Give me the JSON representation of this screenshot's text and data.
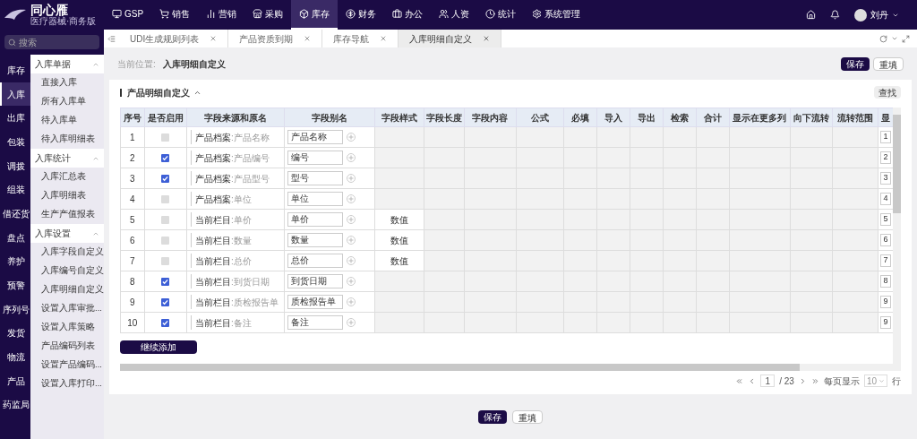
{
  "brand": {
    "name": "同心雁",
    "tagline": "医疗器械·商务版"
  },
  "top_nav": [
    {
      "label": "GSP",
      "selected": false
    },
    {
      "label": "销售",
      "selected": false
    },
    {
      "label": "营销",
      "selected": false
    },
    {
      "label": "采购",
      "selected": false
    },
    {
      "label": "库存",
      "selected": true
    },
    {
      "label": "财务",
      "selected": false
    },
    {
      "label": "办公",
      "selected": false
    },
    {
      "label": "人资",
      "selected": false
    },
    {
      "label": "统计",
      "selected": false
    },
    {
      "label": "系统管理",
      "selected": false
    }
  ],
  "user": {
    "name": "刘丹"
  },
  "search": {
    "placeholder": "搜索"
  },
  "side_nav": [
    {
      "label": "库存",
      "selected": false
    },
    {
      "label": "入库",
      "selected": true
    },
    {
      "label": "出库",
      "selected": false
    },
    {
      "label": "包装",
      "selected": false
    },
    {
      "label": "调拨",
      "selected": false
    },
    {
      "label": "组装",
      "selected": false
    },
    {
      "label": "借还货",
      "selected": false
    },
    {
      "label": "盘点",
      "selected": false
    },
    {
      "label": "养护",
      "selected": false
    },
    {
      "label": "预警",
      "selected": false
    },
    {
      "label": "序列号",
      "selected": false
    },
    {
      "label": "发货",
      "selected": false
    },
    {
      "label": "物流",
      "selected": false
    },
    {
      "label": "产品",
      "selected": false
    },
    {
      "label": "药监局",
      "selected": false
    }
  ],
  "sub_menu": [
    {
      "label": "入库单据",
      "expanded": true,
      "children": [
        "直接入库",
        "所有入库单",
        "待入库单",
        "待入库明细表"
      ]
    },
    {
      "label": "入库统计",
      "expanded": true,
      "children": [
        "入库汇总表",
        "入库明细表",
        "生产产值报表"
      ]
    },
    {
      "label": "入库设置",
      "expanded": true,
      "children": [
        "入库字段自定义",
        "入库编号自定义",
        "入库明细自定义",
        "设置入库审批...",
        "设置入库策略",
        "产品编码列表",
        "设置产品编码...",
        "设置入库打印..."
      ]
    }
  ],
  "tabs": [
    {
      "label": "UDI生成规则列表",
      "selected": false
    },
    {
      "label": "产品资质到期",
      "selected": false
    },
    {
      "label": "库存导航",
      "selected": false
    },
    {
      "label": "入库明细自定义",
      "selected": true
    }
  ],
  "breadcrumb": {
    "prefix": "当前位置:",
    "current": "入库明细自定义"
  },
  "header_buttons": [
    "保存",
    "重填"
  ],
  "section": {
    "title": "产品明细自定义",
    "expanded": true,
    "find_button": "查找"
  },
  "table": {
    "columns": [
      "序号",
      "是否启用",
      "字段来源和原名",
      "字段别名",
      "字段样式",
      "字段长度",
      "字段内容",
      "公式",
      "必填",
      "导入",
      "导出",
      "检索",
      "合计",
      "显示在更多列",
      "向下流转",
      "流转范围",
      "显"
    ],
    "rows": [
      {
        "no": "1",
        "checked": false,
        "disabled": true,
        "source": "产品档案",
        "field": ":产品名称",
        "alias": "产品名称",
        "style": "",
        "last": "1"
      },
      {
        "no": "2",
        "checked": true,
        "disabled": false,
        "source": "产品档案",
        "field": ":产品编号",
        "alias": "编号",
        "style": "",
        "last": "2"
      },
      {
        "no": "3",
        "checked": true,
        "disabled": false,
        "source": "产品档案",
        "field": ":产品型号",
        "alias": "型号",
        "style": "",
        "last": "3"
      },
      {
        "no": "4",
        "checked": false,
        "disabled": true,
        "source": "产品档案",
        "field": ":单位",
        "alias": "单位",
        "style": "",
        "last": "4"
      },
      {
        "no": "5",
        "checked": false,
        "disabled": true,
        "source": "当前栏目",
        "field": ":单价",
        "alias": "单价",
        "style": "数值",
        "last": "5"
      },
      {
        "no": "6",
        "checked": false,
        "disabled": true,
        "source": "当前栏目",
        "field": ":数量",
        "alias": "数量",
        "style": "数值",
        "last": "6"
      },
      {
        "no": "7",
        "checked": false,
        "disabled": true,
        "source": "当前栏目",
        "field": ":总价",
        "alias": "总价",
        "style": "数值",
        "last": "7"
      },
      {
        "no": "8",
        "checked": true,
        "disabled": false,
        "source": "当前栏目",
        "field": ":到货日期",
        "alias": "到货日期",
        "style": "",
        "last": "8"
      },
      {
        "no": "9",
        "checked": true,
        "disabled": false,
        "source": "当前栏目",
        "field": ":质检报告单",
        "alias": "质检报告单",
        "style": "",
        "last": "9"
      },
      {
        "no": "10",
        "checked": true,
        "disabled": false,
        "source": "当前栏目",
        "field": ":备注",
        "alias": "备注",
        "style": "",
        "last": "9"
      }
    ]
  },
  "add_button": "继续添加",
  "pagination": {
    "page": "1",
    "total": "/ 23",
    "per_page_label": "每页显示",
    "per_page": "10",
    "unit": "行"
  },
  "footer_buttons": [
    "保存",
    "重填"
  ]
}
